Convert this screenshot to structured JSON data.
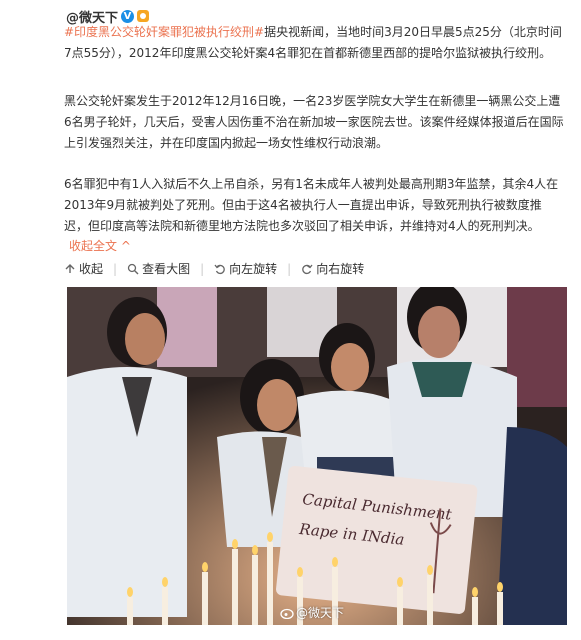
{
  "post": {
    "author": "@微天下",
    "verified_icon": "verified-v-icon",
    "member_icon": "member-badge-icon",
    "topic": "#印度黑公交轮奸案罪犯被执行绞刑#",
    "para1_rest": "据央视新闻，当地时间3月20日早晨5点25分（北京时间7点55分），2012年印度黑公交轮奸案4名罪犯在首都新德里西部的提哈尔监狱被执行绞刑。",
    "para2": "黑公交轮奸案发生于2012年12月16日晚，一名23岁医学院女大学生在新德里一辆黑公交上遭6名男子轮奸，几天后，受害人因伤重不治在新加坡一家医院去世。该案件经媒体报道后在国际上引发强烈关注，并在印度国内掀起一场女性维权行动浪潮。",
    "para3": "6名罪犯中有1人入狱后不久上吊自杀，另有1名未成年人被判处最高刑期3年监禁，其余4人在2013年9月就被判处了死刑。但由于这4名被执行人一直提出申诉，导致死刑执行被数度推迟，但印度高等法院和新德里地方法院也多次驳回了相关申诉，并维持对4人的死刑判决。",
    "collapse_label": "收起全文 ^"
  },
  "toolbar": {
    "collect": "收起",
    "view_large": "查看大图",
    "rotate_left": "向左旋转",
    "rotate_right": "向右旋转"
  },
  "photo": {
    "sign_line1": "Capital Punishment",
    "sign_line2": "Rape in INdia",
    "watermark": "@微天下"
  },
  "colors": {
    "link": "#eb7350",
    "text": "#333333"
  }
}
